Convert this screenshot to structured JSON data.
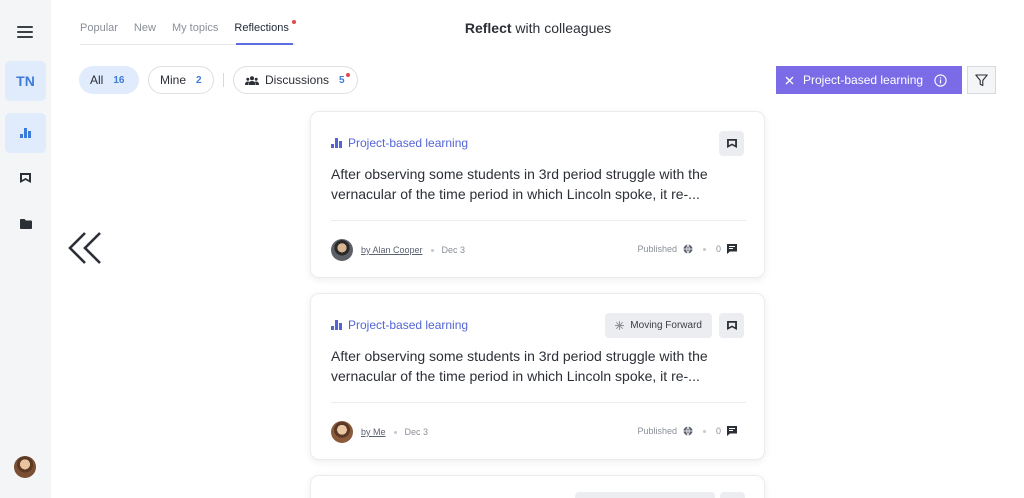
{
  "sidebar": {
    "user_initials": "TN"
  },
  "topnav": {
    "tabs": [
      {
        "label": "Popular"
      },
      {
        "label": "New"
      },
      {
        "label": "My topics"
      },
      {
        "label": "Reflections"
      }
    ],
    "active_tab": "Reflections"
  },
  "title": {
    "bold": "Reflect",
    "rest": " with colleagues"
  },
  "filters": {
    "all_label": "All",
    "all_count": "16",
    "mine_label": "Mine",
    "mine_count": "2",
    "discussions_label": "Discussions",
    "discussions_count": "5"
  },
  "active_topic": {
    "label": "Project-based learning"
  },
  "cards": [
    {
      "topic": "Project-based learning",
      "text": "After observing some students in 3rd period struggle with the vernacular of the time period in which Lincoln spoke, it re-...",
      "author": "by Alan Cooper",
      "date": "Dec 3",
      "status": "Published",
      "comments": "0",
      "tag": ""
    },
    {
      "topic": "Project-based learning",
      "text": "After observing some students in 3rd period struggle with the vernacular of the time period in which Lincoln spoke, it re-...",
      "author": "by Me",
      "date": "Dec 3",
      "status": "Published",
      "comments": "0",
      "tag": "Moving Forward"
    }
  ],
  "colors": {
    "accent": "#7b6be6",
    "link": "#5466d6",
    "highlight": "#e0ebfb",
    "notification": "#e5484d"
  },
  "icons": [
    "menu-icon",
    "bar-chart-icon",
    "bookmark-icon",
    "folder-icon",
    "back-chevrons-icon",
    "close-icon",
    "info-icon",
    "filter-icon",
    "group-icon",
    "globe-icon",
    "comment-icon",
    "sparkle-icon"
  ]
}
